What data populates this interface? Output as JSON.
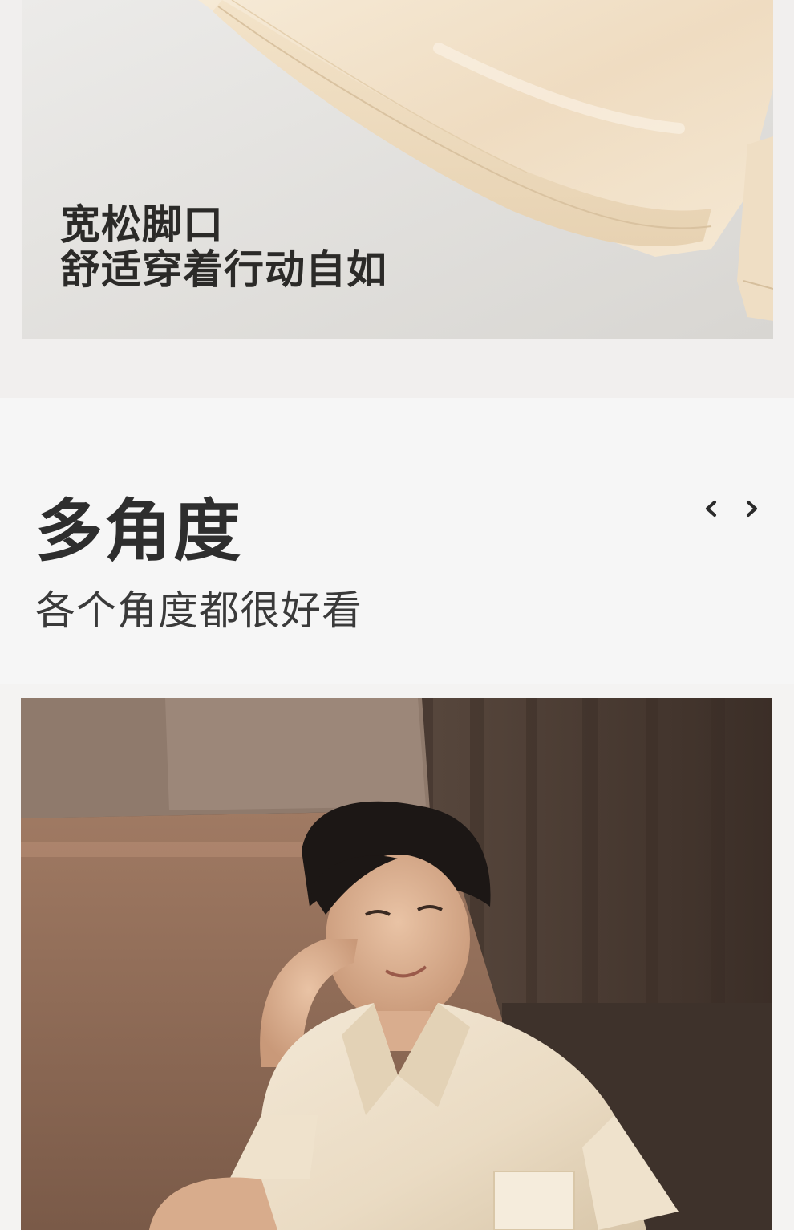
{
  "detail_section": {
    "caption_line1": "宽松脚口",
    "caption_line2": "舒适穿着行动自如",
    "photo_icon": "silk-trouser-hem-photo"
  },
  "angle_section": {
    "title": "多角度",
    "subtitle": "各个角度都很好看",
    "prev_icon": "chevron-left-icon",
    "next_icon": "chevron-right-icon",
    "photo_icon": "model-in-silk-pajamas-photo"
  },
  "colors": {
    "silk": "#f1e3cc",
    "title_text": "#2e2e2e",
    "section_bg": "#f6f6f6"
  }
}
